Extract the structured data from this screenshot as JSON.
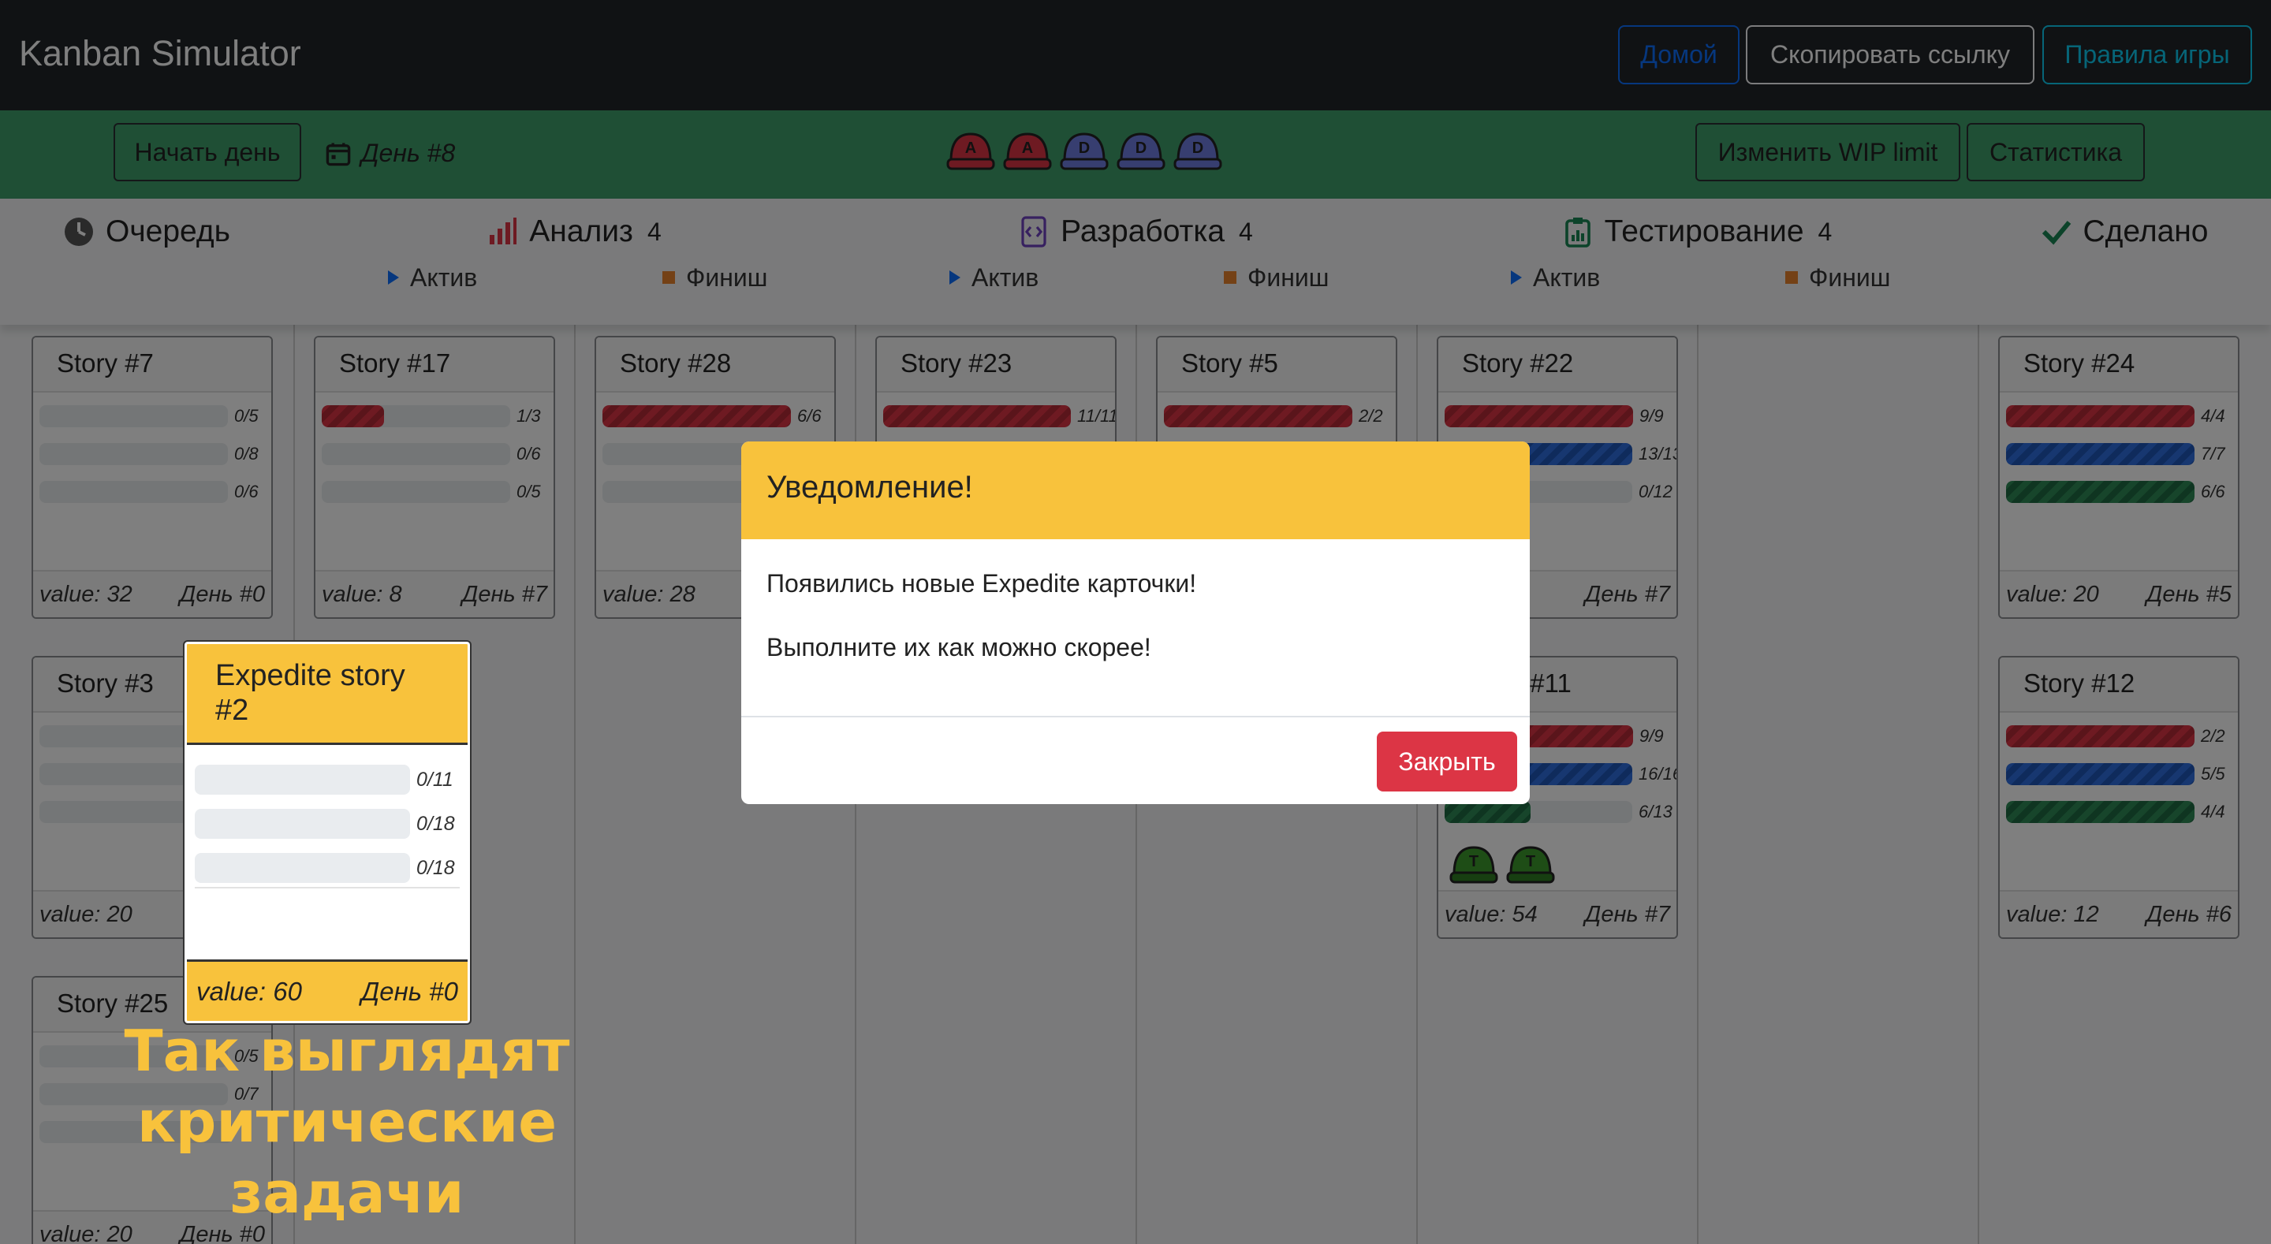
{
  "navbar": {
    "brand": "Kanban Simulator",
    "home": "Домой",
    "copy_link": "Скопировать ссылку",
    "rules": "Правила игры"
  },
  "toolbar": {
    "start_day": "Начать день",
    "day": "День #8",
    "wip": "Изменить WIP limit",
    "stats": "Статистика",
    "workers": [
      {
        "letter": "A",
        "color": "#dc3545"
      },
      {
        "letter": "A",
        "color": "#dc3545"
      },
      {
        "letter": "D",
        "color": "#6f7ce0"
      },
      {
        "letter": "D",
        "color": "#6f7ce0"
      },
      {
        "letter": "D",
        "color": "#6f7ce0"
      }
    ]
  },
  "columns": {
    "queue": "Очередь",
    "analysis": {
      "label": "Анализ",
      "count": "4",
      "active": "Актив",
      "finish": "Финиш"
    },
    "dev": {
      "label": "Разработка",
      "count": "4",
      "active": "Актив",
      "finish": "Финиш"
    },
    "test": {
      "label": "Тестирование",
      "count": "4",
      "active": "Актив",
      "finish": "Финиш"
    },
    "done": "Сделано"
  },
  "cards": {
    "s7": {
      "title": "Story #7",
      "b1": "0/5",
      "b2": "0/8",
      "b3": "0/6",
      "value": "value: 32",
      "day": "День #0"
    },
    "s17": {
      "title": "Story #17",
      "b1": "1/3",
      "b2": "0/6",
      "b3": "0/5",
      "value": "value: 8",
      "day": "День #7"
    },
    "s28": {
      "title": "Story #28",
      "b1": "6/6",
      "value": "value: 28"
    },
    "s23": {
      "title": "Story #23",
      "b1": "11/11"
    },
    "s5": {
      "title": "Story #5",
      "b1": "2/2"
    },
    "s22": {
      "title": "Story #22",
      "b1": "9/9",
      "b2": "13/13",
      "b3": "0/12",
      "day": "День #7"
    },
    "s11": {
      "title": "Story #11",
      "b1": "9/9",
      "b2": "16/16",
      "b3": "6/13",
      "value": "value: 54",
      "day": "День #7"
    },
    "s24": {
      "title": "Story #24",
      "b1": "4/4",
      "b2": "7/7",
      "b3": "6/6",
      "value": "value: 20",
      "day": "День #5"
    },
    "s12": {
      "title": "Story #12",
      "b1": "2/2",
      "b2": "5/5",
      "b3": "4/4",
      "value": "value: 12",
      "day": "День #6"
    },
    "s3": {
      "title": "Story #3",
      "value": "value: 20"
    },
    "s25": {
      "title": "Story #25",
      "b1": "0/5",
      "b2": "0/7",
      "value": "value: 20",
      "day": "День #0"
    }
  },
  "expedite": {
    "title": "Expedite story #2",
    "b1": "0/11",
    "b2": "0/18",
    "b3": "0/18",
    "value": "value: 60",
    "day": "День #0"
  },
  "caption": "Так выглядят критические задачи",
  "modal": {
    "title": "Уведомление!",
    "line1": "Появились новые Expedite карточки!",
    "line2": "Выполните их как можно скорее!",
    "close": "Закрыть"
  }
}
